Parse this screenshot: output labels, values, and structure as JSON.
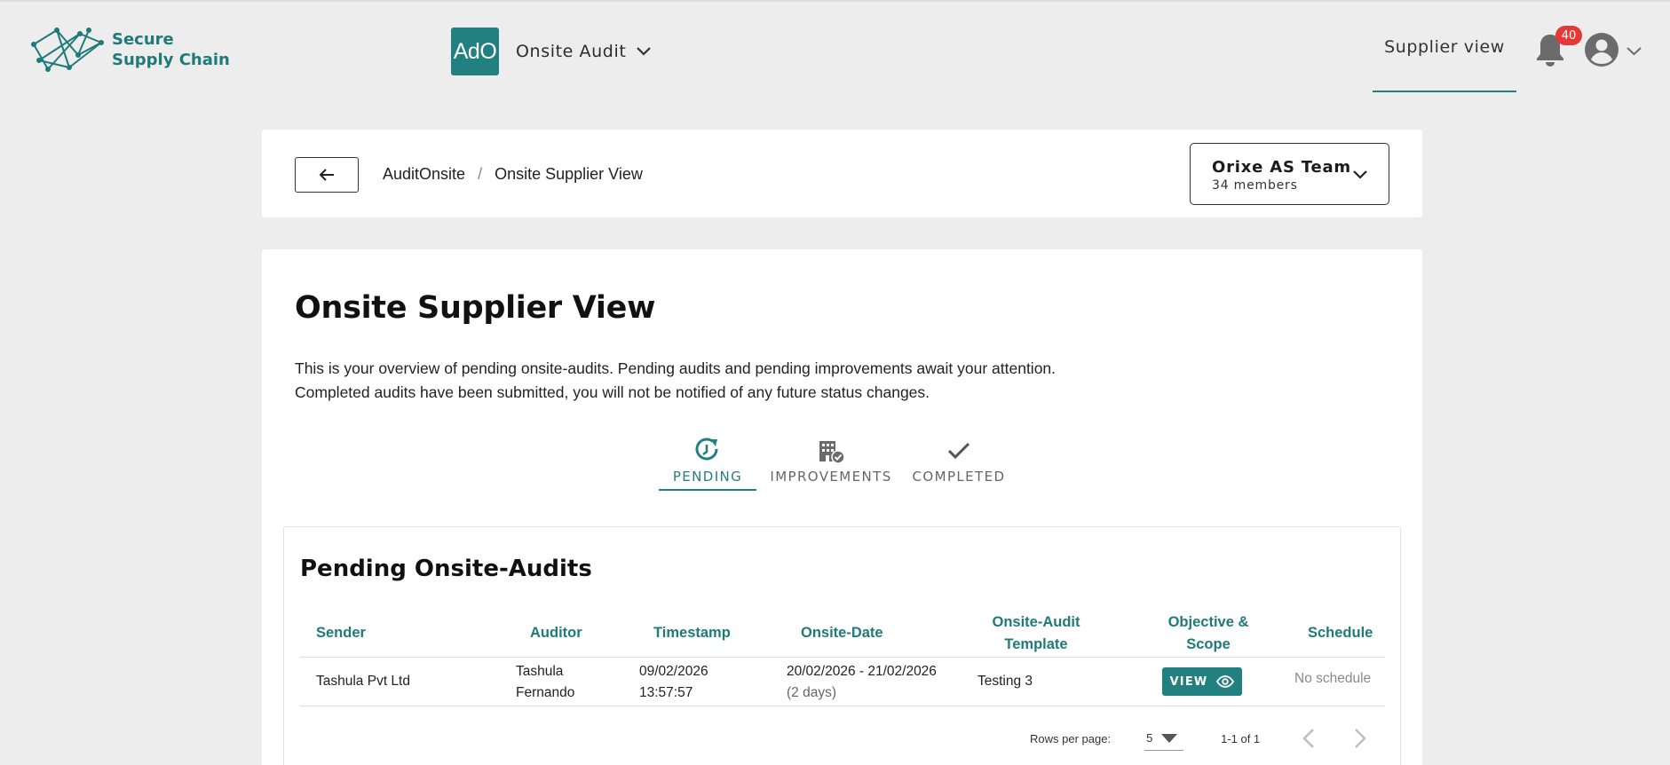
{
  "brand": {
    "line1": "Secure",
    "line2": "Supply Chain"
  },
  "app_switcher": {
    "badge": "AdO",
    "name": "Onsite Audit"
  },
  "nav": {
    "supplier_view": "Supplier view",
    "notification_count": "40"
  },
  "breadcrumb": {
    "items": [
      "AuditOnsite",
      "Onsite Supplier View"
    ],
    "separator": "/"
  },
  "team": {
    "name": "Orixe AS Team",
    "members": "34 members"
  },
  "page": {
    "title": "Onsite Supplier View",
    "description_line1": "This is your overview of pending onsite-audits. Pending audits and pending improvements await your attention.",
    "description_line2": "Completed audits have been submitted, you will not be notified of any future status changes."
  },
  "tabs": [
    {
      "label": "PENDING",
      "icon": "clock-refresh-icon",
      "active": true
    },
    {
      "label": "IMPROVEMENTS",
      "icon": "building-check-icon",
      "active": false
    },
    {
      "label": "COMPLETED",
      "icon": "check-icon",
      "active": false
    }
  ],
  "table": {
    "title": "Pending Onsite-Audits",
    "headers": {
      "sender": "Sender",
      "auditor": "Auditor",
      "timestamp": "Timestamp",
      "onsite_date": "Onsite-Date",
      "template_l1": "Onsite-Audit",
      "template_l2": "Template",
      "objective_l1": "Objective &",
      "objective_l2": "Scope",
      "schedule": "Schedule"
    },
    "rows": [
      {
        "sender": "Tashula Pvt Ltd",
        "auditor_l1": "Tashula",
        "auditor_l2": "Fernando",
        "timestamp_l1": "09/02/2026",
        "timestamp_l2": "13:57:57",
        "onsite_date": "20/02/2026 - 21/02/2026",
        "onsite_duration": "(2 days)",
        "template": "Testing 3",
        "objective_button": "VIEW",
        "schedule": "No schedule"
      }
    ],
    "pagination": {
      "rows_per_page_label": "Rows per page:",
      "rows_per_page": "5",
      "range": "1-1 of 1"
    }
  },
  "colors": {
    "accent": "#238080",
    "badge_red": "#e53935",
    "background": "#ededed"
  }
}
